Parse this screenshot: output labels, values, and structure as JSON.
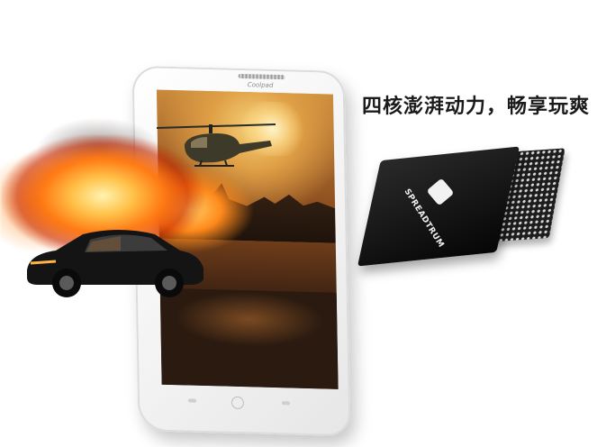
{
  "headline": "四核澎湃动力，畅享玩爽",
  "phone": {
    "brand_text": "Coolpad"
  },
  "chip": {
    "brand_text": "SPREADTRUM"
  },
  "colors": {
    "fire": "#ff8a1c",
    "chip": "#111111",
    "phone": "#f5f5f5"
  },
  "icons": {
    "chip_logo": "spreadtrum-logo-icon",
    "helicopter": "helicopter-icon",
    "car": "car-icon"
  }
}
